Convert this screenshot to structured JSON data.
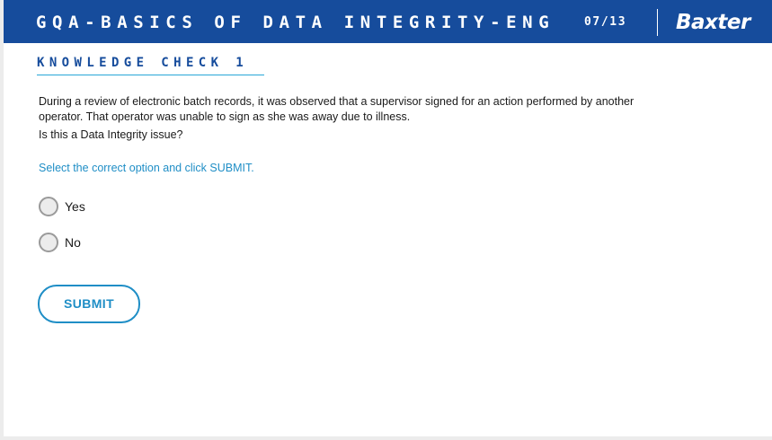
{
  "header": {
    "course_title": "GQA-BASICS OF DATA INTEGRITY-ENG",
    "page_counter": "07/13",
    "logo_text": "Baxter",
    "background_color": "#164c9c"
  },
  "section": {
    "title": "KNOWLEDGE CHECK 1"
  },
  "question": {
    "scenario": "During a review of electronic batch records, it was observed that a supervisor signed for an action performed by another operator. That operator was unable to sign as she was away due to illness.",
    "prompt": "Is this a Data Integrity issue?"
  },
  "instruction": "Select the correct option and click SUBMIT.",
  "options": [
    {
      "label": "Yes",
      "selected": false
    },
    {
      "label": "No",
      "selected": false
    }
  ],
  "submit_label": "SUBMIT",
  "colors": {
    "brand_blue": "#164c9c",
    "accent_blue": "#1f8ec6"
  }
}
